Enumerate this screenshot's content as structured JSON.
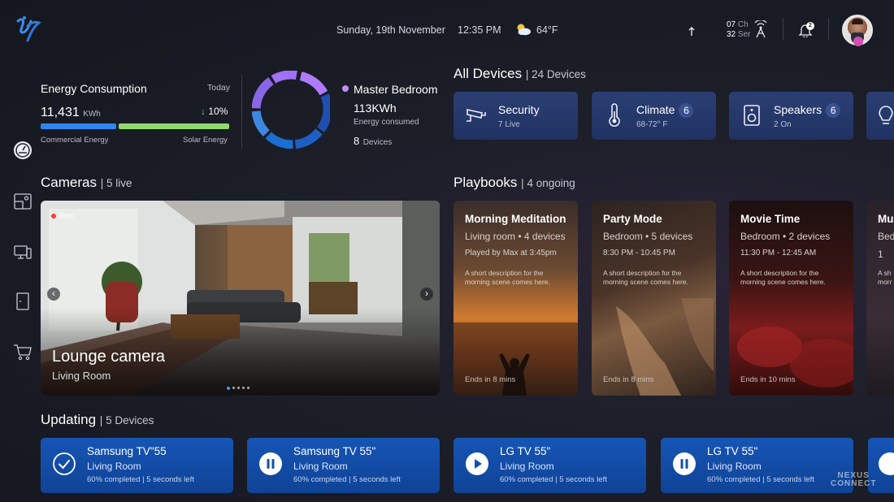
{
  "topbar": {
    "date": "Sunday, 19th November",
    "time": "12:35 PM",
    "weather_icon": "partly-cloudy-icon",
    "temperature": "64°F",
    "channel_num": "07",
    "channel_label": "Ch",
    "server_num": "32",
    "server_label": "Ser",
    "notification_count": "2"
  },
  "energy": {
    "title": "Energy Consumption",
    "period": "Today",
    "value": "11,431",
    "unit": "KWh",
    "change": "10%",
    "commercial_label": "Commercial Energy",
    "solar_label": "Solar Energy",
    "commercial_fraction": 0.4,
    "colors": {
      "commercial": "#2f86ee",
      "solar": "#8fd96d"
    }
  },
  "room": {
    "name": "Master Bedroom",
    "energy": "113KWh",
    "energy_label": "Energy consumed",
    "devices_num": "8",
    "devices_label": "Devices"
  },
  "devices": {
    "title": "All Devices",
    "count": "24 Devices",
    "items": [
      {
        "icon": "security-camera-icon",
        "name": "Security",
        "badge": "",
        "sub": "7 Live"
      },
      {
        "icon": "thermometer-icon",
        "name": "Climate",
        "badge": "6",
        "sub": "68-72° F"
      },
      {
        "icon": "speaker-icon",
        "name": "Speakers",
        "badge": "6",
        "sub": "2 On"
      }
    ]
  },
  "cameras": {
    "title": "Cameras",
    "count": "5 live",
    "rec": "Rec",
    "camera_name": "Lounge camera",
    "camera_room": "Living Room"
  },
  "playbooks": {
    "title": "Playbooks",
    "count": "4 ongoing",
    "items": [
      {
        "title": "Morning Meditation",
        "loc": "Living room • 4 devices",
        "meta": "Played by Max at 3:45pm",
        "desc": "A short description for the morning scene comes here.",
        "ends": "Ends in 8 mins"
      },
      {
        "title": "Party Mode",
        "loc": "Bedroom • 5 devices",
        "meta": "8:30 PM - 10:45 PM",
        "desc": "A short description for the morning scene comes here.",
        "ends": "Ends in 8 mins"
      },
      {
        "title": "Movie Time",
        "loc": "Bedroom • 2 devices",
        "meta": "11:30 PM - 12:45 AM",
        "desc": "A short description for the morning scene comes here.",
        "ends": "Ends in 10 mins"
      },
      {
        "title": "Mu",
        "loc": "Bed",
        "meta": "1",
        "desc": "A sh morr",
        "ends": ""
      }
    ]
  },
  "updating": {
    "title": "Updating",
    "count": "5 Devices",
    "items": [
      {
        "icon": "check-circle-icon",
        "name": "Samsung TV\"55",
        "room": "Living Room",
        "progress": "60% completed",
        "left": "5 seconds left"
      },
      {
        "icon": "pause-circle-icon",
        "name": "Samsung TV 55\"",
        "room": "Living Room",
        "progress": "60% completed",
        "left": "5 seconds left"
      },
      {
        "icon": "play-circle-icon",
        "name": "LG TV 55\"",
        "room": "Living Room",
        "progress": "60% completed",
        "left": "5 seconds left"
      },
      {
        "icon": "pause-circle-icon",
        "name": "LG TV 55\"",
        "room": "Living Room",
        "progress": "60% completed",
        "left": "5 seconds left"
      }
    ]
  },
  "watermark": {
    "line1": "NEXUS",
    "line2": "CONNECT"
  }
}
